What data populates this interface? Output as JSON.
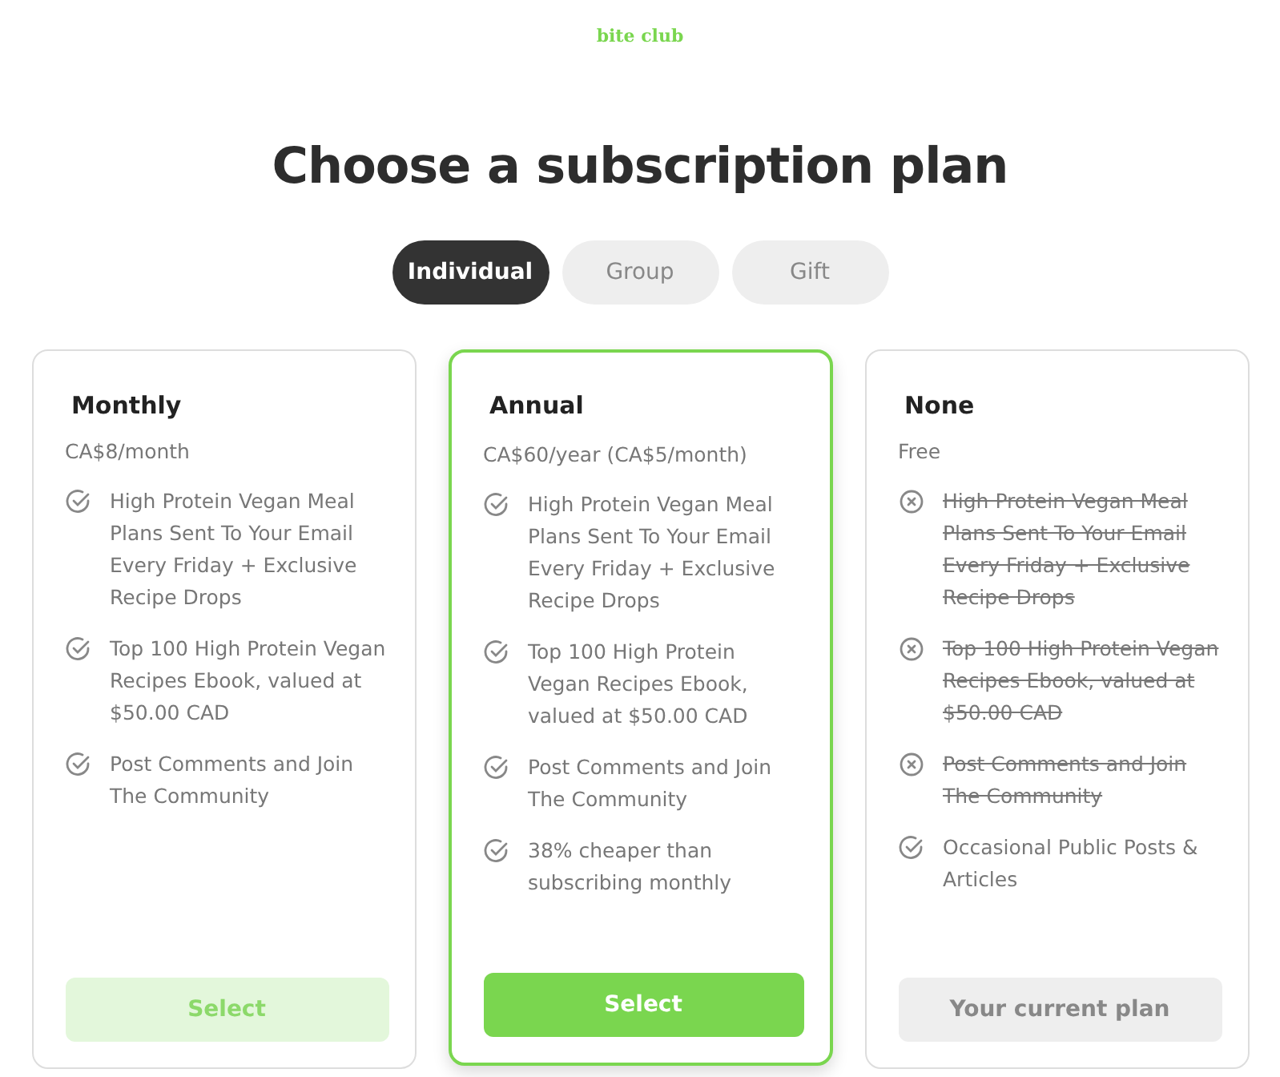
{
  "logo": {
    "text": "bite club"
  },
  "title": "Choose a subscription plan",
  "tabs": [
    {
      "label": "Individual",
      "selected": true
    },
    {
      "label": "Group",
      "selected": false
    },
    {
      "label": "Gift",
      "selected": false
    }
  ],
  "plans": [
    {
      "name": "Monthly",
      "price": "CA$8/month",
      "selected": false,
      "features": [
        {
          "text": "High Protein Vegan Meal Plans Sent To Your Email Every Friday + Exclusive Recipe Drops",
          "included": true
        },
        {
          "text": "Top 100 High Protein Vegan Recipes Ebook, valued at $50.00 CAD",
          "included": true
        },
        {
          "text": "Post Comments and Join The Community",
          "included": true
        }
      ],
      "button": {
        "label": "Select",
        "kind": "light"
      }
    },
    {
      "name": "Annual",
      "price": "CA$60/year (CA$5/month)",
      "selected": true,
      "features": [
        {
          "text": "High Protein Vegan Meal Plans Sent To Your Email Every Friday + Exclusive Recipe Drops",
          "included": true
        },
        {
          "text": "Top 100 High Protein Vegan Recipes Ebook, valued at $50.00 CAD",
          "included": true
        },
        {
          "text": "Post Comments and Join The Community",
          "included": true
        },
        {
          "text": "38% cheaper than subscribing monthly",
          "included": true
        }
      ],
      "button": {
        "label": "Select",
        "kind": "solid"
      }
    },
    {
      "name": "None",
      "price": "Free",
      "selected": false,
      "features": [
        {
          "text": "High Protein Vegan Meal Plans Sent To Your Email Every Friday + Exclusive Recipe Drops",
          "included": false
        },
        {
          "text": "Top 100 High Protein Vegan Recipes Ebook, valued at $50.00 CAD",
          "included": false
        },
        {
          "text": "Post Comments and Join The Community",
          "included": false
        },
        {
          "text": "Occasional Public Posts & Articles",
          "included": true
        }
      ],
      "button": {
        "label": "Your current plan",
        "kind": "current"
      }
    }
  ]
}
